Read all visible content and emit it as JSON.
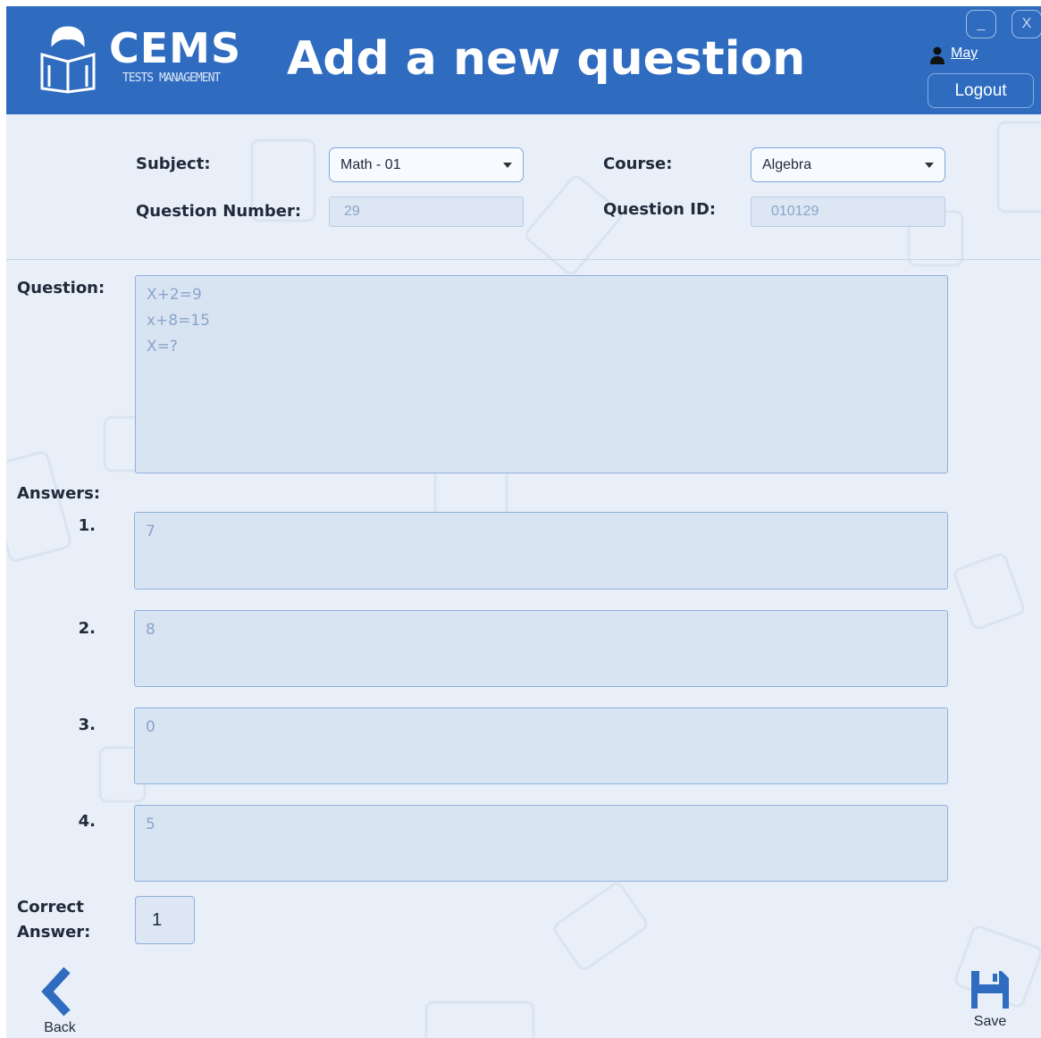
{
  "app": {
    "logo_title": "CEMS",
    "logo_subtitle": "TESTS MANAGEMENT",
    "page_title": "Add a new question",
    "window_controls": {
      "minimize": "_",
      "close": "X"
    },
    "user": {
      "icon": "user-icon",
      "name": "May"
    },
    "logout_label": "Logout",
    "colors": {
      "header": "#2f6cc0",
      "background": "#e8eff8",
      "field": "#d9e4f3"
    }
  },
  "form": {
    "subject": {
      "label": "Subject:",
      "value": "Math - 01"
    },
    "course": {
      "label": "Course:",
      "value": "Algebra"
    },
    "question_number": {
      "label": "Question Number:",
      "value": "29"
    },
    "question_id": {
      "label": "Question ID:",
      "value": "010129"
    },
    "question": {
      "label": "Question:",
      "text": "X+2=9\nx+8=15\nX=?"
    },
    "answers_label": "Answers:",
    "answers": [
      {
        "num": "1.",
        "text": "7"
      },
      {
        "num": "2.",
        "text": "8"
      },
      {
        "num": "3.",
        "text": "0"
      },
      {
        "num": "4.",
        "text": "5"
      }
    ],
    "correct_answer": {
      "label_line1": "Correct",
      "label_line2": "Answer:",
      "value": "1"
    }
  },
  "actions": {
    "back": {
      "label": "Back",
      "icon": "chevron-left-icon"
    },
    "save": {
      "label": "Save",
      "icon": "floppy-disk-icon"
    }
  }
}
